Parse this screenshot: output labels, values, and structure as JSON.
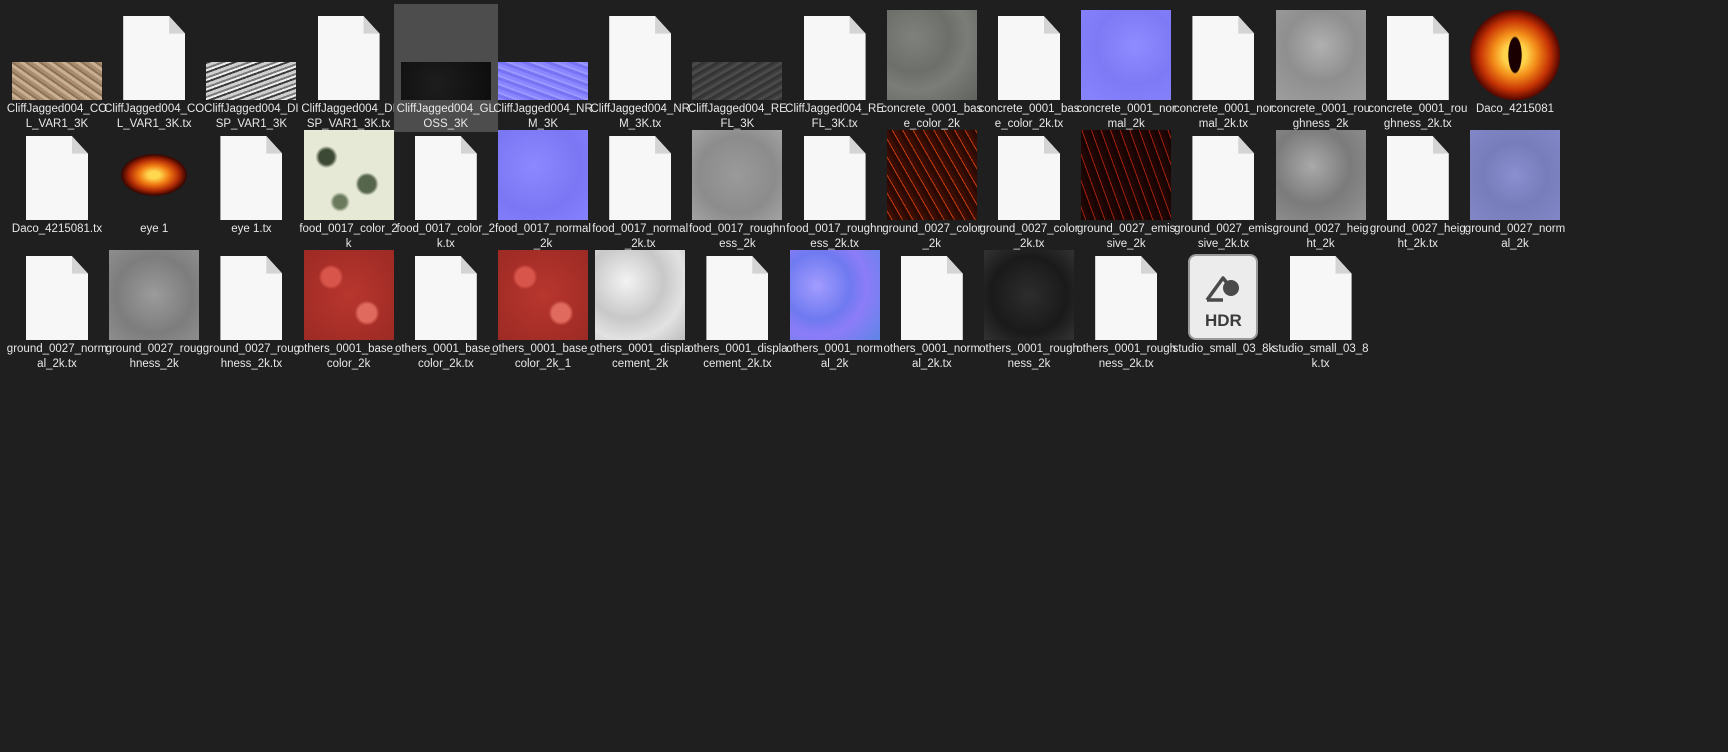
{
  "colors": {
    "background": "#1f1f1f",
    "selection": "#4d4d4d",
    "label_text": "#e8e8e8"
  },
  "files": [
    {
      "name": "CliffJagged004_COL_VAR1_3K",
      "kind": "image",
      "icon": "cliff-color-thumbnail-icon",
      "thumb": "cliff-col",
      "shape": "wide"
    },
    {
      "name": "CliffJagged004_COL_VAR1_3K.tx",
      "kind": "doc",
      "icon": "document-icon"
    },
    {
      "name": "CliffJagged004_DISP_VAR1_3K",
      "kind": "image",
      "icon": "cliff-displacement-thumbnail-icon",
      "thumb": "cliff-disp",
      "shape": "wide"
    },
    {
      "name": "CliffJagged004_DISP_VAR1_3K.tx",
      "kind": "doc",
      "icon": "document-icon"
    },
    {
      "name": "CliffJagged004_GLOSS_3K",
      "kind": "image",
      "icon": "cliff-gloss-thumbnail-icon",
      "thumb": "cliff-gloss",
      "shape": "wide",
      "selected": true
    },
    {
      "name": "CliffJagged004_NRM_3K",
      "kind": "image",
      "icon": "cliff-normal-thumbnail-icon",
      "thumb": "cliff-nrm",
      "shape": "wide"
    },
    {
      "name": "CliffJagged004_NRM_3K.tx",
      "kind": "doc",
      "icon": "document-icon"
    },
    {
      "name": "CliffJagged004_REFL_3K",
      "kind": "image",
      "icon": "cliff-reflection-thumbnail-icon",
      "thumb": "cliff-refl",
      "shape": "wide"
    },
    {
      "name": "CliffJagged004_REFL_3K.tx",
      "kind": "doc",
      "icon": "document-icon"
    },
    {
      "name": "concrete_0001_base_color_2k",
      "kind": "image",
      "icon": "concrete-color-thumbnail-icon",
      "thumb": "concrete-color"
    },
    {
      "name": "concrete_0001_base_color_2k.tx",
      "kind": "doc",
      "icon": "document-icon"
    },
    {
      "name": "concrete_0001_normal_2k",
      "kind": "image",
      "icon": "concrete-normal-thumbnail-icon",
      "thumb": "concrete-normal"
    },
    {
      "name": "concrete_0001_normal_2k.tx",
      "kind": "doc",
      "icon": "document-icon"
    },
    {
      "name": "concrete_0001_roughness_2k",
      "kind": "image",
      "icon": "concrete-roughness-thumbnail-icon",
      "thumb": "concrete-rough"
    },
    {
      "name": "concrete_0001_roughness_2k.tx",
      "kind": "doc",
      "icon": "document-icon"
    },
    {
      "name": "Daco_4215081",
      "kind": "image",
      "icon": "fiery-eye-thumbnail-icon",
      "thumb": "daco"
    },
    {
      "name": "Daco_4215081.tx",
      "kind": "doc",
      "icon": "document-icon"
    },
    {
      "name": "eye 1",
      "kind": "image",
      "icon": "eye-thumbnail-icon",
      "thumb": "eye1"
    },
    {
      "name": "eye 1.tx",
      "kind": "doc",
      "icon": "document-icon"
    },
    {
      "name": "food_0017_color_2k",
      "kind": "image",
      "icon": "food-color-thumbnail-icon",
      "thumb": "food-color"
    },
    {
      "name": "food_0017_color_2k.tx",
      "kind": "doc",
      "icon": "document-icon"
    },
    {
      "name": "food_0017_normal_2k",
      "kind": "image",
      "icon": "food-normal-thumbnail-icon",
      "thumb": "food-normal"
    },
    {
      "name": "food_0017_normal_2k.tx",
      "kind": "doc",
      "icon": "document-icon"
    },
    {
      "name": "food_0017_roughness_2k",
      "kind": "image",
      "icon": "food-roughness-thumbnail-icon",
      "thumb": "food-rough"
    },
    {
      "name": "food_0017_roughness_2k.tx",
      "kind": "doc",
      "icon": "document-icon"
    },
    {
      "name": "ground_0027_color_2k",
      "kind": "image",
      "icon": "ground-color-thumbnail-icon",
      "thumb": "ground-color"
    },
    {
      "name": "ground_0027_color_2k.tx",
      "kind": "doc",
      "icon": "document-icon"
    },
    {
      "name": "ground_0027_emissive_2k",
      "kind": "image",
      "icon": "ground-emissive-thumbnail-icon",
      "thumb": "ground-emissive"
    },
    {
      "name": "ground_0027_emissive_2k.tx",
      "kind": "doc",
      "icon": "document-icon"
    },
    {
      "name": "ground_0027_height_2k",
      "kind": "image",
      "icon": "ground-height-thumbnail-icon",
      "thumb": "ground-height"
    },
    {
      "name": "ground_0027_height_2k.tx",
      "kind": "doc",
      "icon": "document-icon"
    },
    {
      "name": "ground_0027_normal_2k",
      "kind": "image",
      "icon": "ground-normal-thumbnail-icon",
      "thumb": "ground-normal"
    },
    {
      "name": "ground_0027_normal_2k.tx",
      "kind": "doc",
      "icon": "document-icon"
    },
    {
      "name": "ground_0027_roughness_2k",
      "kind": "image",
      "icon": "ground-roughness-thumbnail-icon",
      "thumb": "ground-rough"
    },
    {
      "name": "ground_0027_roughness_2k.tx",
      "kind": "doc",
      "icon": "document-icon"
    },
    {
      "name": "others_0001_base_color_2k",
      "kind": "image",
      "icon": "others-color-thumbnail-icon",
      "thumb": "others-color"
    },
    {
      "name": "others_0001_base_color_2k.tx",
      "kind": "doc",
      "icon": "document-icon"
    },
    {
      "name": "others_0001_base_color_2k_1",
      "kind": "image",
      "icon": "others-color-thumbnail-icon",
      "thumb": "others-color"
    },
    {
      "name": "others_0001_displacement_2k",
      "kind": "image",
      "icon": "others-displacement-thumbnail-icon",
      "thumb": "others-disp"
    },
    {
      "name": "others_0001_displacement_2k.tx",
      "kind": "doc",
      "icon": "document-icon"
    },
    {
      "name": "others_0001_normal_2k",
      "kind": "image",
      "icon": "others-normal-thumbnail-icon",
      "thumb": "others-normal"
    },
    {
      "name": "others_0001_normal_2k.tx",
      "kind": "doc",
      "icon": "document-icon"
    },
    {
      "name": "others_0001_roughness_2k",
      "kind": "image",
      "icon": "others-roughness-thumbnail-icon",
      "thumb": "others-rough"
    },
    {
      "name": "others_0001_roughness_2k.tx",
      "kind": "doc",
      "icon": "document-icon"
    },
    {
      "name": "studio_small_03_8k",
      "kind": "hdr",
      "icon": "hdr-file-icon",
      "badge": "HDR"
    },
    {
      "name": "studio_small_03_8k.tx",
      "kind": "doc",
      "icon": "document-icon"
    }
  ]
}
